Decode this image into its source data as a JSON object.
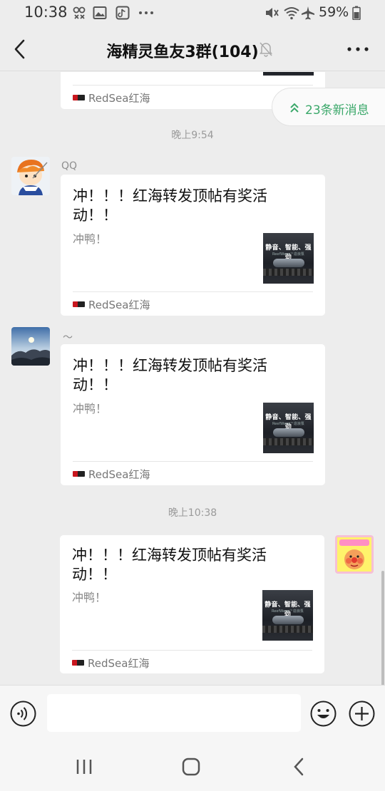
{
  "status_bar": {
    "time": "10:38",
    "battery_percent": "59%",
    "icons": [
      "mute-icon",
      "wifi-icon",
      "airplane-icon",
      "battery-icon"
    ]
  },
  "header": {
    "title": "海精灵鱼友3群(104)",
    "muted": true
  },
  "new_messages_label": "23条新消息",
  "messages": [
    {
      "source": "RedSea红海"
    },
    {
      "time": "晚上9:54"
    },
    {
      "sender": "QQ",
      "title": "冲！！！红海转发顶帖有奖活动！！",
      "desc": "冲鸭！",
      "thumb_title": "静音、智能、强劲",
      "thumb_sub": "ReefWave™造浪泵",
      "source": "RedSea红海"
    },
    {
      "sender": "～",
      "title": "冲！！！红海转发顶帖有奖活动！！",
      "desc": "冲鸭！",
      "thumb_title": "静音、智能、强劲",
      "thumb_sub": "ReefWave™造浪泵",
      "source": "RedSea红海"
    },
    {
      "time": "晚上10:38"
    },
    {
      "sender": "me",
      "title": "冲！！！红海转发顶帖有奖活动！！",
      "desc": "冲鸭！",
      "thumb_title": "静音、智能、强劲",
      "thumb_sub": "ReefWave™造浪泵",
      "source": "RedSea红海"
    }
  ],
  "input": {
    "value": "",
    "placeholder": ""
  },
  "colors": {
    "background": "#ededed",
    "card": "#ffffff",
    "accent_green": "#3ba86a"
  }
}
